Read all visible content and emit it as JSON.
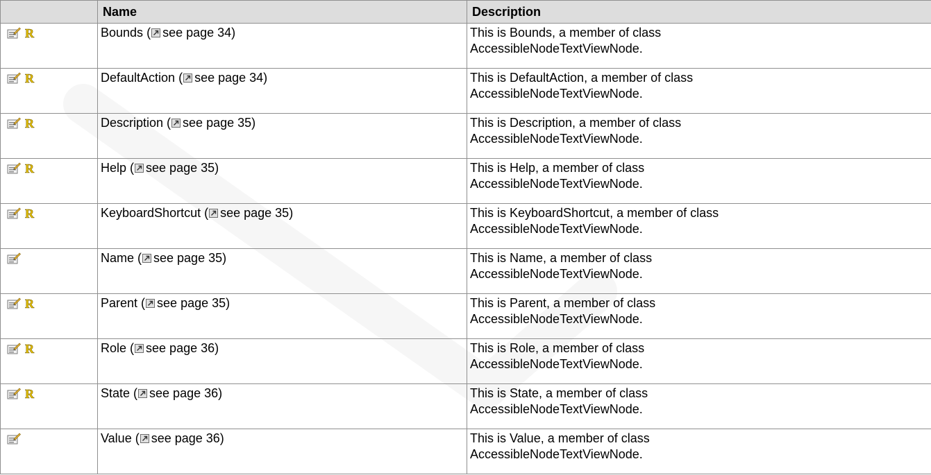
{
  "table": {
    "headers": {
      "icon": "",
      "name": "Name",
      "description": "Description"
    },
    "rows": [
      {
        "name": "Bounds",
        "page_ref": "see page 34",
        "desc_line1": "This is Bounds, a member of class",
        "desc_line2": "AccessibleNodeTextViewNode.",
        "icons": [
          "property-icon",
          "read-only-icon"
        ]
      },
      {
        "name": "DefaultAction",
        "page_ref": "see page 34",
        "desc_line1": "This is DefaultAction, a member of class",
        "desc_line2": "AccessibleNodeTextViewNode.",
        "icons": [
          "property-icon",
          "read-only-icon"
        ]
      },
      {
        "name": "Description",
        "page_ref": "see page 35",
        "desc_line1": "This is Description, a member of class",
        "desc_line2": "AccessibleNodeTextViewNode.",
        "icons": [
          "property-icon",
          "read-only-icon"
        ]
      },
      {
        "name": "Help",
        "page_ref": "see page 35",
        "desc_line1": "This is Help, a member of class",
        "desc_line2": "AccessibleNodeTextViewNode.",
        "icons": [
          "property-icon",
          "read-only-icon"
        ]
      },
      {
        "name": "KeyboardShortcut",
        "page_ref": "see page 35",
        "desc_line1": "This is KeyboardShortcut, a member of class",
        "desc_line2": "AccessibleNodeTextViewNode.",
        "icons": [
          "property-icon",
          "read-only-icon"
        ]
      },
      {
        "name": "Name",
        "page_ref": "see page 35",
        "desc_line1": "This is Name, a member of class",
        "desc_line2": "AccessibleNodeTextViewNode.",
        "icons": [
          "property-icon"
        ]
      },
      {
        "name": "Parent",
        "page_ref": "see page 35",
        "desc_line1": "This is Parent, a member of class",
        "desc_line2": "AccessibleNodeTextViewNode.",
        "icons": [
          "property-icon",
          "read-only-icon"
        ]
      },
      {
        "name": "Role",
        "page_ref": "see page 36",
        "desc_line1": "This is Role, a member of class",
        "desc_line2": "AccessibleNodeTextViewNode.",
        "icons": [
          "property-icon",
          "read-only-icon"
        ]
      },
      {
        "name": "State",
        "page_ref": "see page 36",
        "desc_line1": "This is State, a member of class",
        "desc_line2": "AccessibleNodeTextViewNode.",
        "icons": [
          "property-icon",
          "read-only-icon"
        ]
      },
      {
        "name": "Value",
        "page_ref": "see page 36",
        "desc_line1": "This is Value, a member of class",
        "desc_line2": "AccessibleNodeTextViewNode.",
        "icons": [
          "property-icon"
        ]
      }
    ]
  },
  "colors": {
    "header_background": "#dddddd",
    "border": "#8f8f8f",
    "read_only_badge": "#e8c200"
  }
}
